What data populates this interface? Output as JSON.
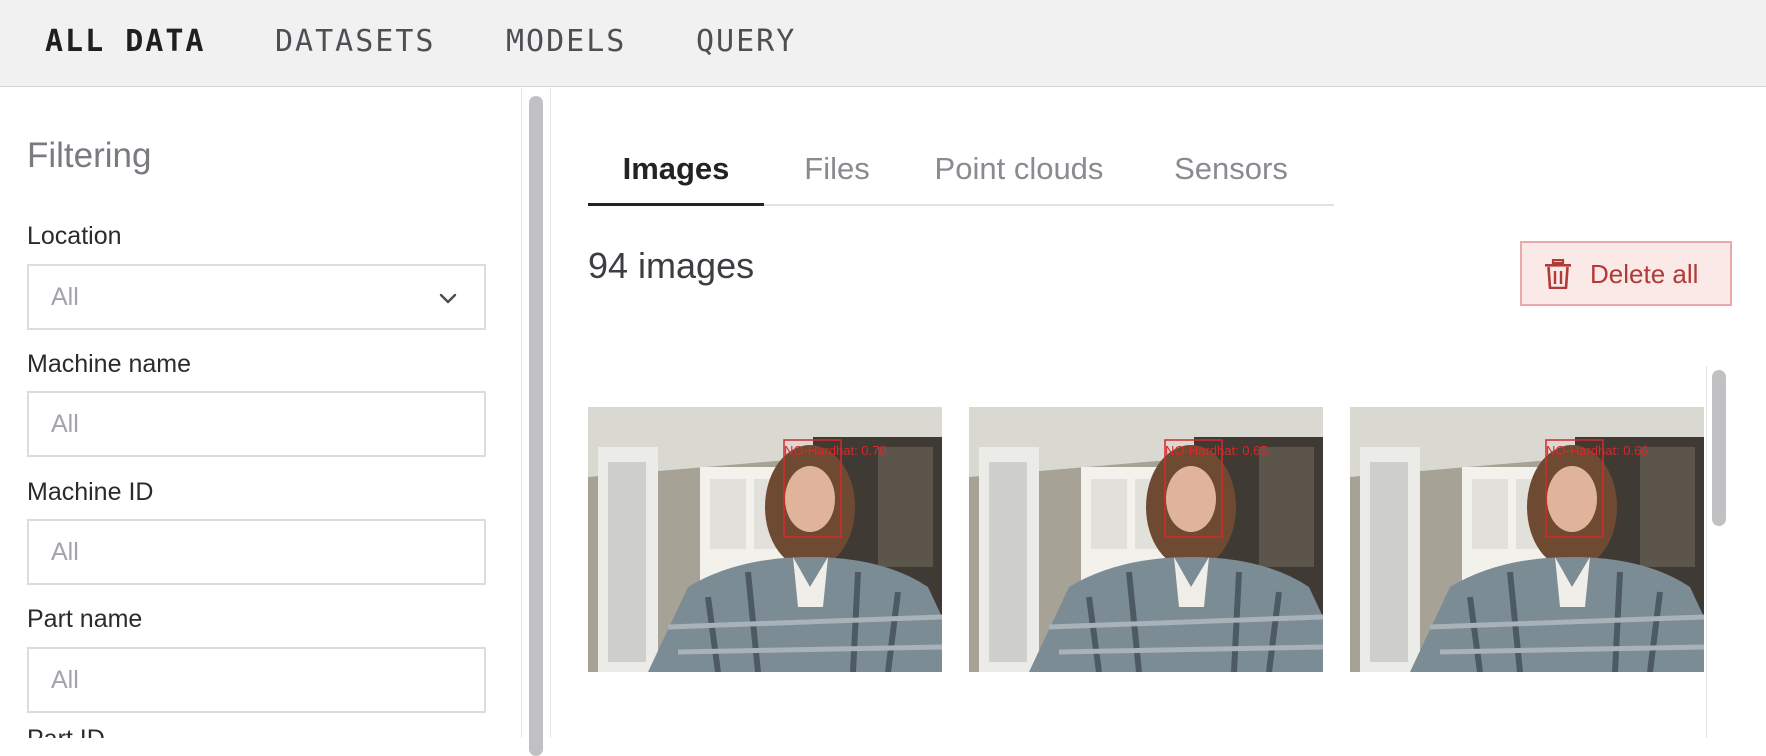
{
  "nav": {
    "items": [
      {
        "label": "ALL DATA",
        "active": true
      },
      {
        "label": "DATASETS",
        "active": false
      },
      {
        "label": "MODELS",
        "active": false
      },
      {
        "label": "QUERY",
        "active": false
      }
    ]
  },
  "sidebar": {
    "title": "Filtering",
    "fields": {
      "location": {
        "label": "Location",
        "value": "All",
        "type": "select"
      },
      "machine_name": {
        "label": "Machine name",
        "placeholder": "All"
      },
      "machine_id": {
        "label": "Machine ID",
        "placeholder": "All"
      },
      "part_name": {
        "label": "Part name",
        "placeholder": "All"
      },
      "part_id_partial": {
        "label": "Part ID"
      }
    }
  },
  "main": {
    "tabs": [
      {
        "label": "Images",
        "active": true
      },
      {
        "label": "Files",
        "active": false
      },
      {
        "label": "Point clouds",
        "active": false
      },
      {
        "label": "Sensors",
        "active": false
      }
    ],
    "count_heading": "94 images",
    "delete_button": {
      "label": "Delete all",
      "icon": "trash-icon"
    },
    "images": [
      {
        "overlay_label": "NO-Hardhat: 0.70"
      },
      {
        "overlay_label": "NO-Hardhat: 0.65"
      },
      {
        "overlay_label": "NO-Hardhat: 0.66"
      }
    ]
  },
  "colors": {
    "nav_bg": "#f1f1f2",
    "danger_text": "#b03a37",
    "danger_bg": "#fbe9e7",
    "danger_border": "#e8aaa8",
    "detection_box": "#d8282a"
  }
}
